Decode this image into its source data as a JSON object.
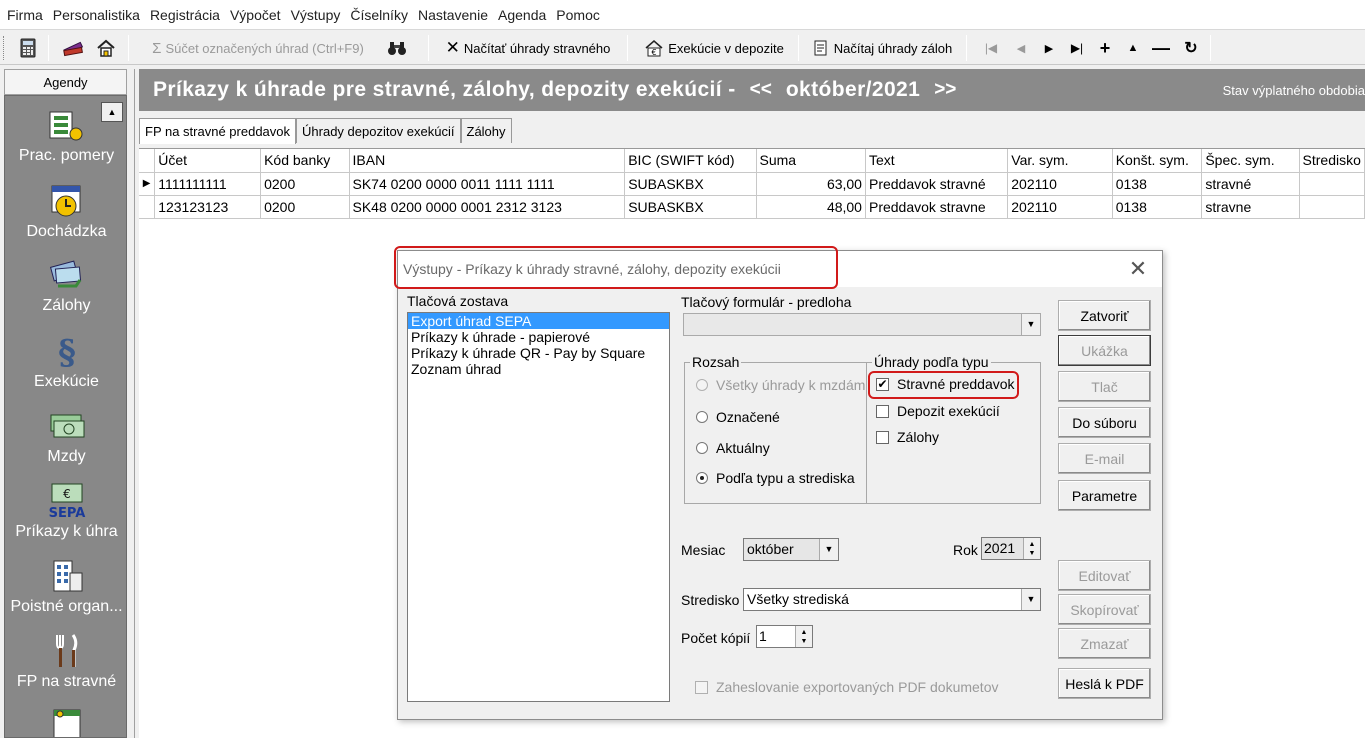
{
  "menu": [
    "Firma",
    "Personalistika",
    "Registrácia",
    "Výpočet",
    "Výstupy",
    "Číselníky",
    "Nastavenie",
    "Agenda",
    "Pomoc"
  ],
  "toolbar": {
    "sum_label": "Súčet označených úhrad (Ctrl+F9)",
    "load_meal_label": "Načítať úhrady stravného",
    "execution_label": "Exekúcie v depozite",
    "load_advances_label": "Načítaj úhrady záloh"
  },
  "agendy": {
    "header": "Agendy",
    "items": [
      "Prac. pomery",
      "Dochádzka",
      "Zálohy",
      "Exekúcie",
      "Mzdy",
      "Príkazy k úhra",
      "Poistné organ...",
      "FP na stravné"
    ]
  },
  "banner": {
    "title": "Príkazy k úhrade pre stravné, zálohy, depozity exekúcií -",
    "prev": "<<",
    "period": "október/2021",
    "next": ">>",
    "status": "Stav výplatného obdobia"
  },
  "tabs": [
    "FP na stravné preddavok",
    "Úhrady depozitov exekúcií",
    "Zálohy"
  ],
  "grid": {
    "columns": [
      "Účet",
      "Kód banky",
      "IBAN",
      "BIC (SWIFT kód)",
      "Suma",
      "Text",
      "Var. sym.",
      "Konšt. sym.",
      "Špec. sym.",
      "Stredisko"
    ],
    "rows": [
      [
        "1111111111",
        "0200",
        "SK74 0200 0000 0011 1111 1111",
        "SUBASKBX",
        "63,00",
        "Preddavok stravné",
        "202110",
        "0138",
        "stravné",
        ""
      ],
      [
        "123123123",
        "0200",
        "SK48 0200 0000 0001 2312 3123",
        "SUBASKBX",
        "48,00",
        "Preddavok stravne",
        "202110",
        "0138",
        "stravne",
        ""
      ]
    ]
  },
  "dialog": {
    "title": "Výstupy - Príkazy k úhrady stravné, zálohy, depozity exekúcii",
    "report_label": "Tlačová zostava",
    "reports": [
      "Export úhrad SEPA",
      "Príkazy k úhrade - papierové",
      "Príkazy k úhrade QR - Pay by Square",
      "Zoznam úhrad"
    ],
    "form_label": "Tlačový formulár - predloha",
    "range_title": "Rozsah",
    "range_options": [
      "Všetky úhrady k mzdám",
      "Označené",
      "Aktuálny",
      "Podľa typu a strediska"
    ],
    "type_title": "Úhrady podľa typu",
    "type_options": [
      "Stravné preddavok",
      "Depozit exekúcií",
      "Zálohy"
    ],
    "month_label": "Mesiac",
    "month_value": "október",
    "year_label": "Rok",
    "year_value": "2021",
    "center_label": "Stredisko",
    "center_value": "Všetky strediská",
    "copies_label": "Počet kópií",
    "copies_value": "1",
    "pdf_password_label": "Zaheslovanie exportovaných PDF dokumetov",
    "buttons": {
      "close": "Zatvoriť",
      "preview": "Ukážka",
      "print": "Tlač",
      "to_file": "Do súboru",
      "email": "E-mail",
      "params": "Parametre",
      "edit": "Editovať",
      "copy": "Skopírovať",
      "delete": "Zmazať",
      "pdf_pass": "Heslá k PDF"
    }
  }
}
